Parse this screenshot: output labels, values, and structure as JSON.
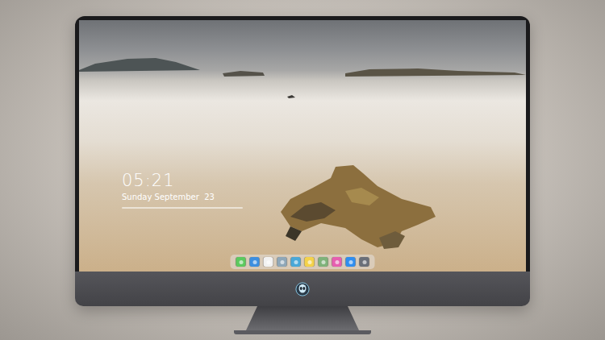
{
  "lock_screen": {
    "time": "05:21",
    "date": "Sunday September  23"
  },
  "dock": {
    "items": [
      {
        "color": "#5cc95e"
      },
      {
        "color": "#3d8fe0"
      },
      {
        "color": "#f2f2f2"
      },
      {
        "color": "#8fa7b8"
      },
      {
        "color": "#4aa8d8"
      },
      {
        "color": "#f4d24a"
      },
      {
        "color": "#7fb27a"
      },
      {
        "color": "#e65fb0"
      },
      {
        "color": "#2f8ef0"
      },
      {
        "color": "#6a6f78"
      }
    ]
  }
}
